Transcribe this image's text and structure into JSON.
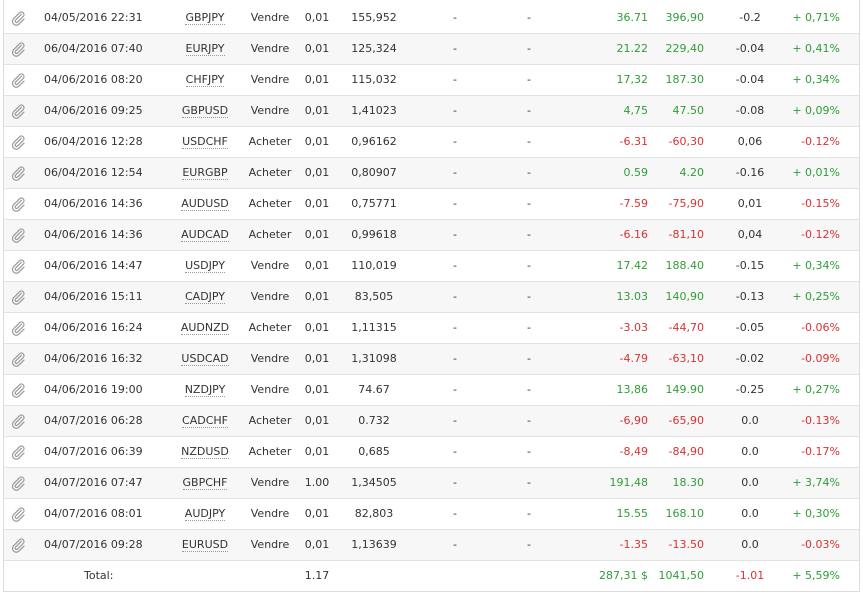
{
  "colors": {
    "positive": "#2e9e36",
    "negative": "#d93232",
    "row_alt": "#f7f7f7",
    "border": "#e3e3e3"
  },
  "row_icon": "paperclip-icon",
  "trades": [
    {
      "date": "04/05/2016 22:31",
      "symbol": "GBPJPY",
      "type": "Vendre",
      "lot": "0,01",
      "price": "155,952",
      "sl": "-",
      "tp": "-",
      "points": "36.71",
      "pips": "396,90",
      "swap": "-0.2",
      "percent": "+ 0,71%",
      "sign": "pos"
    },
    {
      "date": "06/04/2016 07:40",
      "symbol": "EURJPY",
      "type": "Vendre",
      "lot": "0,01",
      "price": "125,324",
      "sl": "-",
      "tp": "-",
      "points": "21.22",
      "pips": "229,40",
      "swap": "-0.04",
      "percent": "+ 0,41%",
      "sign": "pos"
    },
    {
      "date": "04/06/2016 08:20",
      "symbol": "CHFJPY",
      "type": "Vendre",
      "lot": "0,01",
      "price": "115,032",
      "sl": "-",
      "tp": "-",
      "points": "17,32",
      "pips": "187.30",
      "swap": "-0.04",
      "percent": "+ 0,34%",
      "sign": "pos"
    },
    {
      "date": "04/06/2016 09:25",
      "symbol": "GBPUSD",
      "type": "Vendre",
      "lot": "0,01",
      "price": "1,41023",
      "sl": "-",
      "tp": "-",
      "points": "4,75",
      "pips": "47.50",
      "swap": "-0.08",
      "percent": "+ 0,09%",
      "sign": "pos"
    },
    {
      "date": "06/04/2016 12:28",
      "symbol": "USDCHF",
      "type": "Acheter",
      "lot": "0,01",
      "price": "0,96162",
      "sl": "-",
      "tp": "-",
      "points": "-6.31",
      "pips": "-60,30",
      "swap": "0,06",
      "percent": "-0.12%",
      "sign": "neg"
    },
    {
      "date": "06/04/2016 12:54",
      "symbol": "EURGBP",
      "type": "Acheter",
      "lot": "0,01",
      "price": "0,80907",
      "sl": "-",
      "tp": "-",
      "points": "0.59",
      "pips": "4.20",
      "swap": "-0.16",
      "percent": "+ 0,01%",
      "sign": "pos"
    },
    {
      "date": "04/06/2016 14:36",
      "symbol": "AUDUSD",
      "type": "Acheter",
      "lot": "0,01",
      "price": "0,75771",
      "sl": "-",
      "tp": "-",
      "points": "-7.59",
      "pips": "-75,90",
      "swap": "0,01",
      "percent": "-0.15%",
      "sign": "neg"
    },
    {
      "date": "04/06/2016 14:36",
      "symbol": "AUDCAD",
      "type": "Acheter",
      "lot": "0,01",
      "price": "0,99618",
      "sl": "-",
      "tp": "-",
      "points": "-6.16",
      "pips": "-81,10",
      "swap": "0,04",
      "percent": "-0.12%",
      "sign": "neg"
    },
    {
      "date": "04/06/2016 14:47",
      "symbol": "USDJPY",
      "type": "Vendre",
      "lot": "0,01",
      "price": "110,019",
      "sl": "-",
      "tp": "-",
      "points": "17.42",
      "pips": "188.40",
      "swap": "-0.15",
      "percent": "+ 0,34%",
      "sign": "pos"
    },
    {
      "date": "04/06/2016 15:11",
      "symbol": "CADJPY",
      "type": "Vendre",
      "lot": "0,01",
      "price": "83,505",
      "sl": "-",
      "tp": "-",
      "points": "13.03",
      "pips": "140,90",
      "swap": "-0.13",
      "percent": "+ 0,25%",
      "sign": "pos"
    },
    {
      "date": "04/06/2016 16:24",
      "symbol": "AUDNZD",
      "type": "Acheter",
      "lot": "0,01",
      "price": "1,11315",
      "sl": "-",
      "tp": "-",
      "points": "-3.03",
      "pips": "-44,70",
      "swap": "-0.05",
      "percent": "-0.06%",
      "sign": "neg"
    },
    {
      "date": "04/06/2016 16:32",
      "symbol": "USDCAD",
      "type": "Vendre",
      "lot": "0,01",
      "price": "1,31098",
      "sl": "-",
      "tp": "-",
      "points": "-4.79",
      "pips": "-63,10",
      "swap": "-0.02",
      "percent": "-0.09%",
      "sign": "neg"
    },
    {
      "date": "04/06/2016 19:00",
      "symbol": "NZDJPY",
      "type": "Vendre",
      "lot": "0,01",
      "price": "74.67",
      "sl": "-",
      "tp": "-",
      "points": "13,86",
      "pips": "149.90",
      "swap": "-0.25",
      "percent": "+ 0,27%",
      "sign": "pos"
    },
    {
      "date": "04/07/2016 06:28",
      "symbol": "CADCHF",
      "type": "Acheter",
      "lot": "0,01",
      "price": "0.732",
      "sl": "-",
      "tp": "-",
      "points": "-6,90",
      "pips": "-65,90",
      "swap": "0.0",
      "percent": "-0.13%",
      "sign": "neg"
    },
    {
      "date": "04/07/2016 06:39",
      "symbol": "NZDUSD",
      "type": "Acheter",
      "lot": "0,01",
      "price": "0,685",
      "sl": "-",
      "tp": "-",
      "points": "-8,49",
      "pips": "-84,90",
      "swap": "0.0",
      "percent": "-0.17%",
      "sign": "neg"
    },
    {
      "date": "04/07/2016 07:47",
      "symbol": "GBPCHF",
      "type": "Vendre",
      "lot": "1.00",
      "price": "1,34505",
      "sl": "-",
      "tp": "-",
      "points": "191,48",
      "pips": "18.30",
      "swap": "0.0",
      "percent": "+ 3,74%",
      "sign": "pos"
    },
    {
      "date": "04/07/2016 08:01",
      "symbol": "AUDJPY",
      "type": "Vendre",
      "lot": "0,01",
      "price": "82,803",
      "sl": "-",
      "tp": "-",
      "points": "15.55",
      "pips": "168.10",
      "swap": "0.0",
      "percent": "+ 0,30%",
      "sign": "pos"
    },
    {
      "date": "04/07/2016 09:28",
      "symbol": "EURUSD",
      "type": "Vendre",
      "lot": "0,01",
      "price": "1,13639",
      "sl": "-",
      "tp": "-",
      "points": "-1.35",
      "pips": "-13.50",
      "swap": "0.0",
      "percent": "-0.03%",
      "sign": "neg"
    }
  ],
  "total": {
    "label": "Total:",
    "lot": "1.17",
    "points": "287,31 $",
    "pips": "1041,50",
    "swap": "-1.01",
    "percent": "+ 5,59%"
  }
}
